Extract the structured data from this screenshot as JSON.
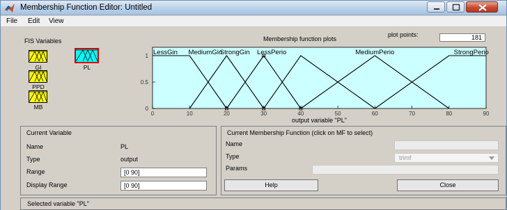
{
  "window": {
    "title": "Membership Function Editor: Untitled"
  },
  "menu": {
    "items": [
      "File",
      "Edit",
      "View"
    ]
  },
  "fis_variables": {
    "label": "FIS Variables",
    "vars": [
      {
        "name": "GI",
        "selected": false
      },
      {
        "name": "PL",
        "selected": true
      },
      {
        "name": "PPD",
        "selected": false
      },
      {
        "name": "MB",
        "selected": false
      }
    ]
  },
  "plot": {
    "title": "Membership function plots",
    "plot_points_label": "plot points:",
    "plot_points_value": "181",
    "xlabel": "output variable \"PL\""
  },
  "chart_data": {
    "type": "line",
    "xlim": [
      0,
      90
    ],
    "ylim": [
      0,
      1
    ],
    "x_ticks": [
      "0",
      "10",
      "20",
      "30",
      "40",
      "50",
      "60",
      "70",
      "80",
      "90"
    ],
    "y_ticks": [
      "0",
      "0.5",
      "1"
    ],
    "xlabel": "output variable \"PL\"",
    "background_color": "#ccffff",
    "series": [
      {
        "name": "LessGin",
        "x": [
          0,
          10,
          20
        ],
        "y": [
          1,
          1,
          0
        ]
      },
      {
        "name": "MediumGin",
        "x": [
          10,
          20,
          30
        ],
        "y": [
          0,
          1,
          0
        ]
      },
      {
        "name": "StrongGin",
        "x": [
          20,
          30,
          40
        ],
        "y": [
          0,
          1,
          0
        ]
      },
      {
        "name": "LessPerio",
        "x": [
          30,
          40,
          60
        ],
        "y": [
          0,
          1,
          0
        ]
      },
      {
        "name": "MediumPerio",
        "x": [
          40,
          60,
          80
        ],
        "y": [
          0,
          1,
          0
        ]
      },
      {
        "name": "StrongPerio",
        "x": [
          60,
          80,
          90
        ],
        "y": [
          0,
          1,
          1
        ]
      }
    ],
    "series_labels": [
      "LessGin",
      "MediumGin",
      "StrongGin",
      "LessPerio",
      "MediumPerio",
      "StrongPerio"
    ],
    "series_labels_shown": [
      "LessGin",
      "MediumGin",
      "StrongGin",
      "LessPerio",
      "MediumPerio",
      "StrongPerio"
    ]
  },
  "current_variable": {
    "title": "Current Variable",
    "name_label": "Name",
    "name_value": "PL",
    "type_label": "Type",
    "type_value": "output",
    "range_label": "Range",
    "range_value": "[0 90]",
    "display_range_label": "Display Range",
    "display_range_value": "[0 90]"
  },
  "current_mf": {
    "title": "Current Membership Function (click on MF to select)",
    "name_label": "Name",
    "name_value": "",
    "type_label": "Type",
    "type_value": "trimf",
    "params_label": "Params",
    "params_value": ""
  },
  "buttons": {
    "help": "Help",
    "close": "Close"
  },
  "status": {
    "text": "Selected variable \"PL\""
  },
  "colors": {
    "plot_bg": "#ccffff",
    "selected_var": "#00ffff",
    "var_box": "#ffff00",
    "selected_border": "#d40000"
  }
}
